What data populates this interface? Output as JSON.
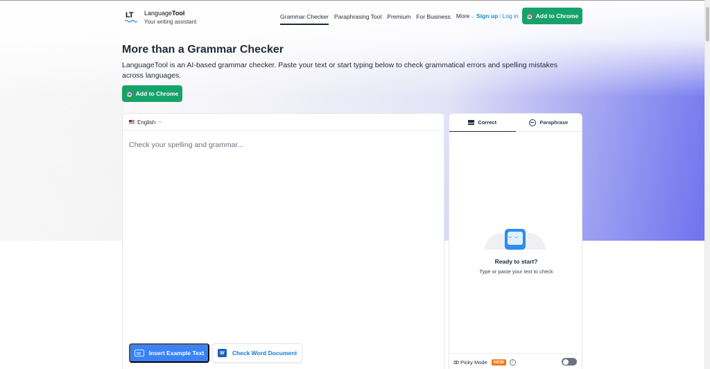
{
  "header": {
    "brand_name_plain": "Language",
    "brand_name_bold": "Tool",
    "tagline": "Your writing assistant",
    "nav": [
      {
        "label": "Grammar Checker",
        "active": true
      },
      {
        "label": "Paraphrasing Tool",
        "active": false
      },
      {
        "label": "Premium",
        "active": false
      },
      {
        "label": "For Business",
        "active": false
      },
      {
        "label": "More",
        "active": false
      }
    ],
    "signup_label": "Sign up",
    "separator": "/",
    "login_label": "Log in",
    "add_to_chrome_label": "Add to Chrome"
  },
  "hero": {
    "title": "More than a Grammar Checker",
    "description": "LanguageTool is an AI-based grammar checker. Paste your text or start typing below to check grammatical errors and spelling mistakes across languages.",
    "add_to_chrome_label": "Add to Chrome"
  },
  "editor": {
    "language": "English",
    "placeholder": "Check your spelling and grammar...",
    "insert_example_label": "Insert Example Text",
    "check_word_label": "Check Word Document",
    "word_icon_letter": "W"
  },
  "sidebar": {
    "tabs": [
      {
        "label": "Correct",
        "active": true
      },
      {
        "label": "Paraphrase",
        "active": false
      }
    ],
    "ready_title": "Ready to start?",
    "ready_subtitle": "Type or paste your text to check",
    "picky_mode_label": "Picky Mode",
    "new_badge": "NEW",
    "picky_mode_on": false
  },
  "colors": {
    "accent_green": "#16a26b",
    "link_blue": "#0f8ad8",
    "primary_blue": "#3b82f6",
    "badge_orange": "#f97316"
  }
}
